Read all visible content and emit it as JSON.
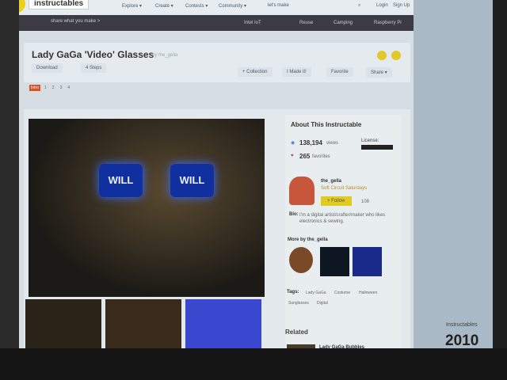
{
  "nav": {
    "brand": "instructables",
    "items": [
      "Explore ▾",
      "Create ▾",
      "Contests ▾",
      "Community ▾"
    ],
    "slogan": "let's make",
    "login": "Login",
    "signup": "Sign Up",
    "tagline": "share what you make >",
    "channels": [
      "Intel IoT",
      "Reuse",
      "Camping",
      "Raspberry Pi"
    ]
  },
  "header": {
    "title": "Lady GaGa 'Video' Glasses",
    "author": "by the_gella",
    "download": "Download",
    "steps": "4 Steps",
    "collection": "+ Collection",
    "made_it": "I Made it!",
    "favorite": "Favorite",
    "share": "Share ▾",
    "pages": [
      "Intro",
      "1",
      "2",
      "3",
      "4"
    ]
  },
  "image": {
    "lens_text": "WILL"
  },
  "sidebar": {
    "heading": "About This Instructable",
    "views": "138,194",
    "views_label": "views",
    "favorites": "265",
    "favorites_label": "favorites",
    "license": "License:",
    "author": "the_gella",
    "group": "Soft Circuit Saturdays",
    "follow": "+ Follow",
    "followers": "108",
    "bio_label": "Bio:",
    "bio": "I'm a digital artist/crafter/maker who likes electronics & sewing.",
    "more_by": "More by the_gella",
    "tags_label": "Tags:",
    "tags": [
      "Lady GaGa",
      "Costume",
      "Halloween",
      "Sunglasses",
      "Digital"
    ],
    "related": "Related",
    "related_item": "Lady GaGa Bubbles"
  },
  "watermark": {
    "brand": "Instructables",
    "year": "2010"
  }
}
